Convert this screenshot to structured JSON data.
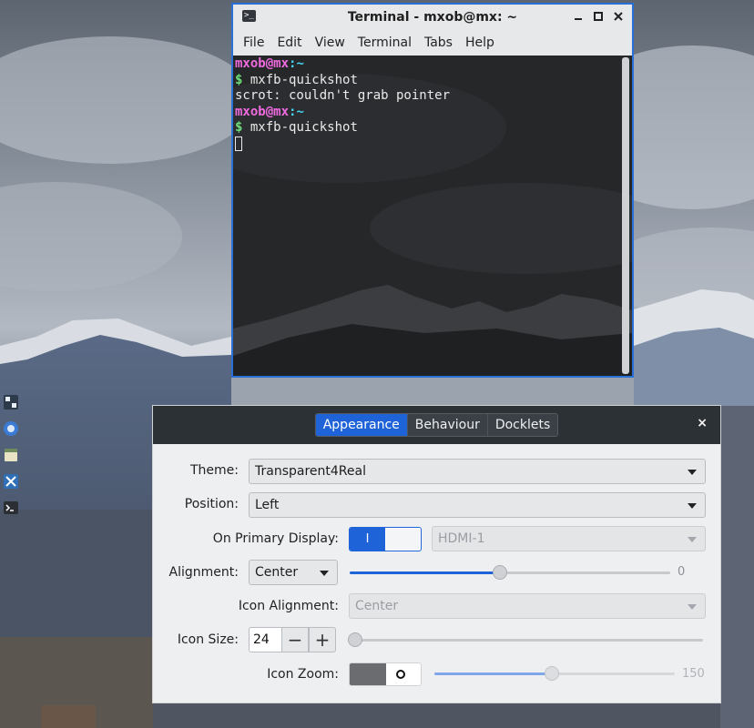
{
  "terminal": {
    "title": "Terminal - mxob@mx: ~",
    "menu": [
      "File",
      "Edit",
      "View",
      "Terminal",
      "Tabs",
      "Help"
    ],
    "lines": [
      {
        "user": "mxob",
        "at": "@",
        "host": "mx",
        "path": ":~"
      },
      {
        "prompt": "$",
        "cmd": " mxfb-quickshot"
      },
      {
        "text": "scrot: couldn't grab pointer"
      },
      {
        "user": "mxob",
        "at": "@",
        "host": "mx",
        "path": ":~"
      },
      {
        "prompt": "$",
        "cmd": " mxfb-quickshot"
      }
    ]
  },
  "dock_icons": [
    "mx-logo-icon",
    "browser-icon",
    "file-manager-icon",
    "mx-tools-icon",
    "terminal-icon"
  ],
  "settings": {
    "tabs": [
      "Appearance",
      "Behaviour",
      "Docklets"
    ],
    "active_tab": "Appearance",
    "close_label": "×",
    "theme": {
      "label": "Theme:",
      "value": "Transparent4Real"
    },
    "position": {
      "label": "Position:",
      "value": "Left"
    },
    "primary_display": {
      "label": "On Primary Display:",
      "toggle_text": "I",
      "toggle_on": true,
      "display_value": "HDMI-1"
    },
    "alignment": {
      "label": "Alignment:",
      "value": "Center",
      "offset_value": "0",
      "offset_fraction": 0.47
    },
    "icon_alignment": {
      "label": "Icon Alignment:",
      "value": "Center"
    },
    "icon_size": {
      "label": "Icon Size:",
      "value": "24",
      "minus": "−",
      "plus": "+",
      "slider_fraction": 0.0
    },
    "icon_zoom": {
      "label": "Icon Zoom:",
      "toggle_on": false,
      "toggle_off_text": "O",
      "zoom_value": "150",
      "slider_fraction": 0.49
    }
  },
  "colors": {
    "accent": "#1f63d8",
    "panel_header": "#2c3136",
    "terminal_bg": "#232426"
  }
}
